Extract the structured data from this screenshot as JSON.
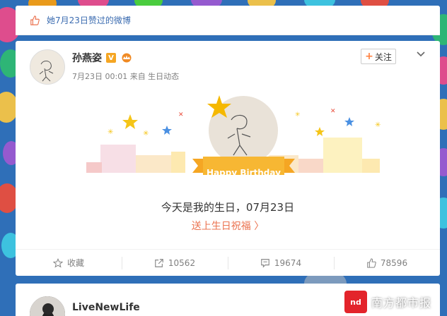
{
  "liked_bar": {
    "text": "她7月23日赞过的微博",
    "icon": "thumb-up-icon"
  },
  "post": {
    "author": "孙燕姿",
    "meta": "7月23日 00:01 来自 生日动态",
    "follow_label": "关注",
    "birthday_banner": "Happy Birthday",
    "birthday_text": "今天是我的生日，07月23日",
    "birthday_link": "送上生日祝福 〉"
  },
  "actions": [
    {
      "icon": "star-icon",
      "label": "收藏"
    },
    {
      "icon": "share-icon",
      "label": "10562"
    },
    {
      "icon": "comment-icon",
      "label": "19674"
    },
    {
      "icon": "like-icon",
      "label": "78596"
    }
  ],
  "next_post": {
    "author": "LiveNewLife"
  },
  "watermark": {
    "logo": "nd",
    "text": "南方都市报"
  },
  "colors": {
    "link_blue": "#3a6bb0",
    "accent_orange": "#eb7350",
    "banner_orange": "#f5a623"
  }
}
